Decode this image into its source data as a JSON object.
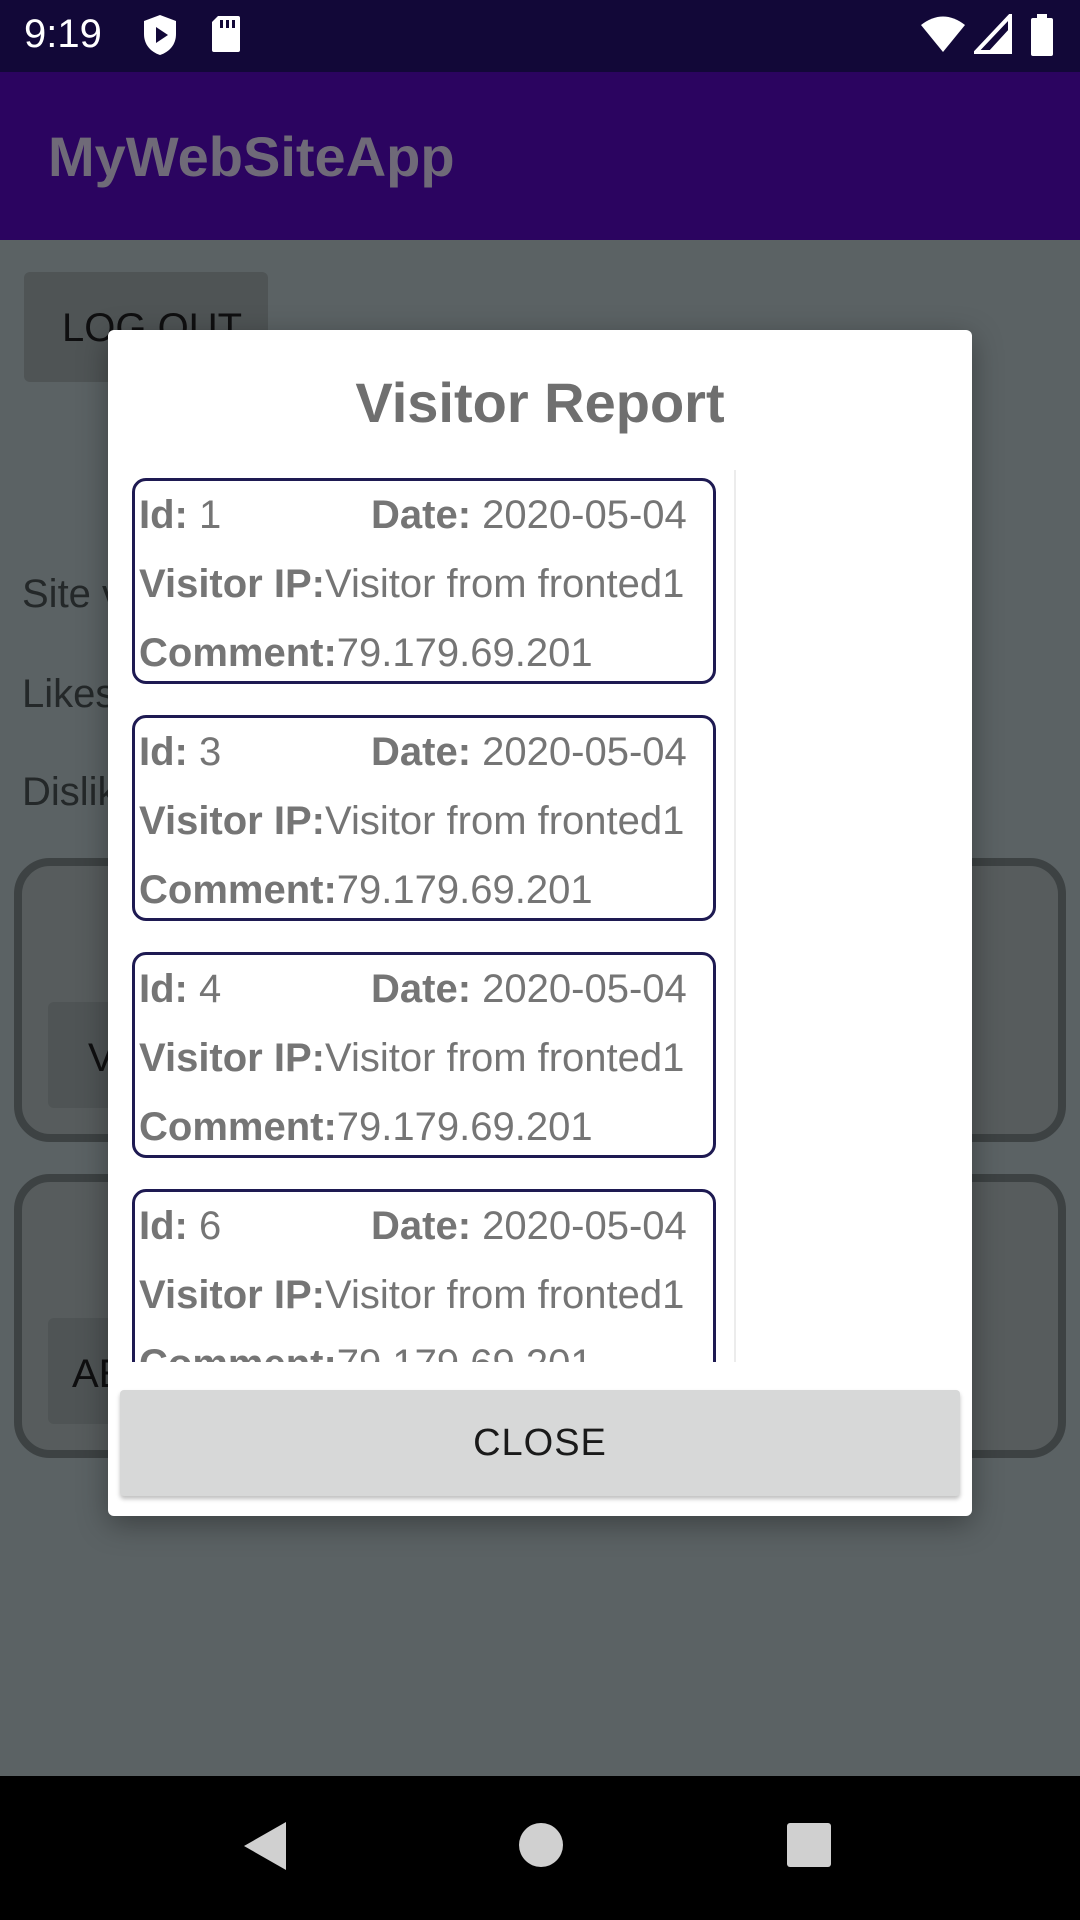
{
  "status_bar": {
    "time": "9:19",
    "icons": [
      "shield-icon",
      "sd-card-icon",
      "wifi-icon",
      "signal-icon",
      "battery-icon"
    ]
  },
  "app": {
    "title": "MyWebSiteApp"
  },
  "background": {
    "logout_label": "LOG OUT",
    "text1": "Site v",
    "text2": "Likes",
    "text3": "Dislik",
    "card1_button_label": "V",
    "card2_button_label": "AE"
  },
  "dialog": {
    "title": "Visitor Report",
    "close_label": "CLOSE",
    "field_labels": {
      "id": "Id:",
      "date": "Date:",
      "visitor_ip": "Visitor IP:",
      "comment": "Comment:"
    },
    "records": [
      {
        "id": "1",
        "date": "2020-05-04",
        "visitor_ip": "Visitor from fronted1",
        "comment": "79.179.69.201"
      },
      {
        "id": "3",
        "date": "2020-05-04",
        "visitor_ip": "Visitor from fronted1",
        "comment": "79.179.69.201"
      },
      {
        "id": "4",
        "date": "2020-05-04",
        "visitor_ip": "Visitor from fronted1",
        "comment": "79.179.69.201"
      },
      {
        "id": "6",
        "date": "2020-05-04",
        "visitor_ip": "Visitor from fronted1",
        "comment": "79.179.69.201"
      }
    ]
  },
  "colors": {
    "status_bar": "#120838",
    "app_bar": "#2b0460",
    "card_border": "#1e1a52",
    "scrim": "#5b6264"
  }
}
